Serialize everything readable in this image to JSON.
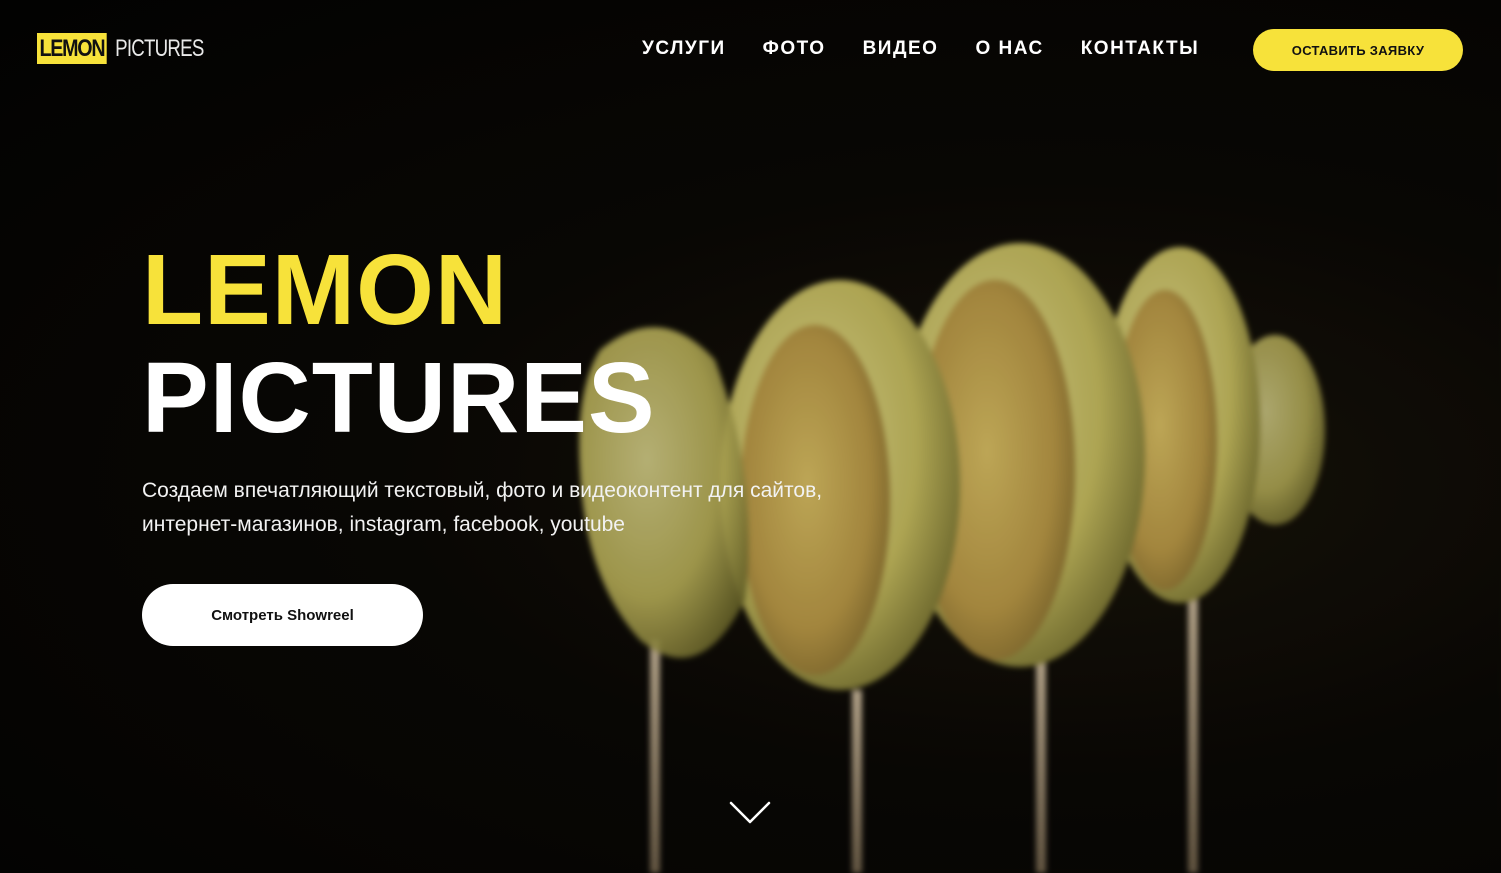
{
  "brand": {
    "logo_word_1": "LEMON",
    "logo_word_2": "PICTURES",
    "accent_color": "#f7e23a"
  },
  "nav": {
    "items": [
      {
        "label": "УСЛУГИ"
      },
      {
        "label": "ФОТО"
      },
      {
        "label": "ВИДЕО"
      },
      {
        "label": "О НАС"
      },
      {
        "label": "КОНТАКТЫ"
      }
    ],
    "cta_label": "ОСТАВИТЬ ЗАЯВКУ"
  },
  "hero": {
    "title_line_1": "LEMON",
    "title_line_2": "PICTURES",
    "subtitle_line_1": "Создаем впечатляющий текстовый, фото и видеоконтент для сайтов,",
    "subtitle_line_2": "интернет-магазинов, instagram, facebook, youtube",
    "button_label": "Смотреть Showreel"
  },
  "icons": {
    "scroll": "chevron-down-icon"
  }
}
